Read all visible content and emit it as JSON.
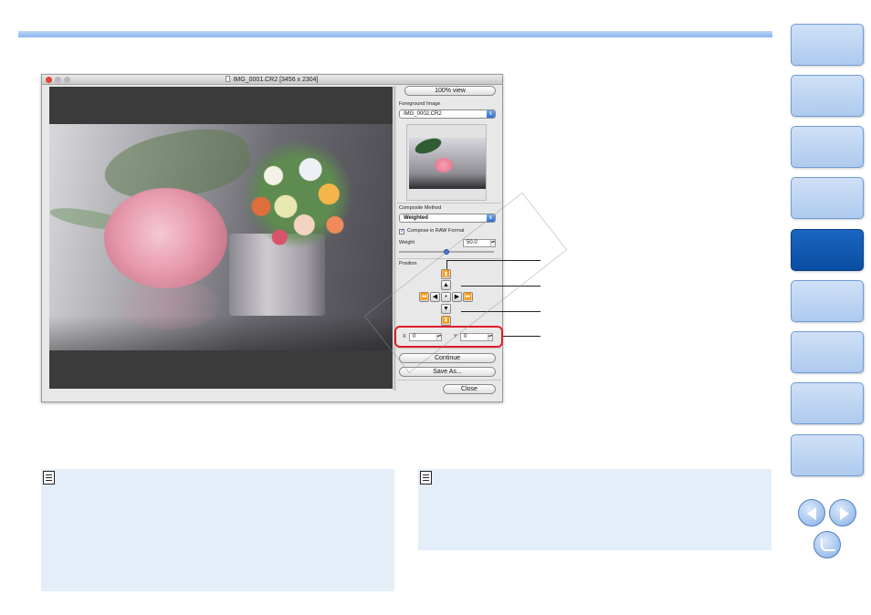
{
  "window": {
    "title": "IMG_0001.CR2 [3456 x 2304]"
  },
  "panel": {
    "view_button": "100% view",
    "foreground_label": "Foreground Image",
    "foreground_value": "IMG_0002.CR2",
    "composite_label": "Composite Method",
    "composite_value": "Weighted",
    "raw_checkbox_label": "Compose in RAW Format",
    "weight_label": "Weight",
    "weight_value": "50.0",
    "position_label": "Position",
    "x_label": "X",
    "x_value": "0",
    "y_label": "Y",
    "y_value": "0",
    "continue_button": "Continue",
    "save_as_button": "Save As...",
    "close_button": "Close"
  },
  "position_arrows": {
    "up_fast": "⏫",
    "up": "▲",
    "left_fast": "⏪",
    "left": "◀",
    "center": "•",
    "right": "▶",
    "right_fast": "⏩",
    "down": "▼",
    "down_fast": "⏬"
  },
  "colors": {
    "accent": "#0a4ea2",
    "highlight": "#e01c2a",
    "note_bg": "#e3eef9"
  }
}
